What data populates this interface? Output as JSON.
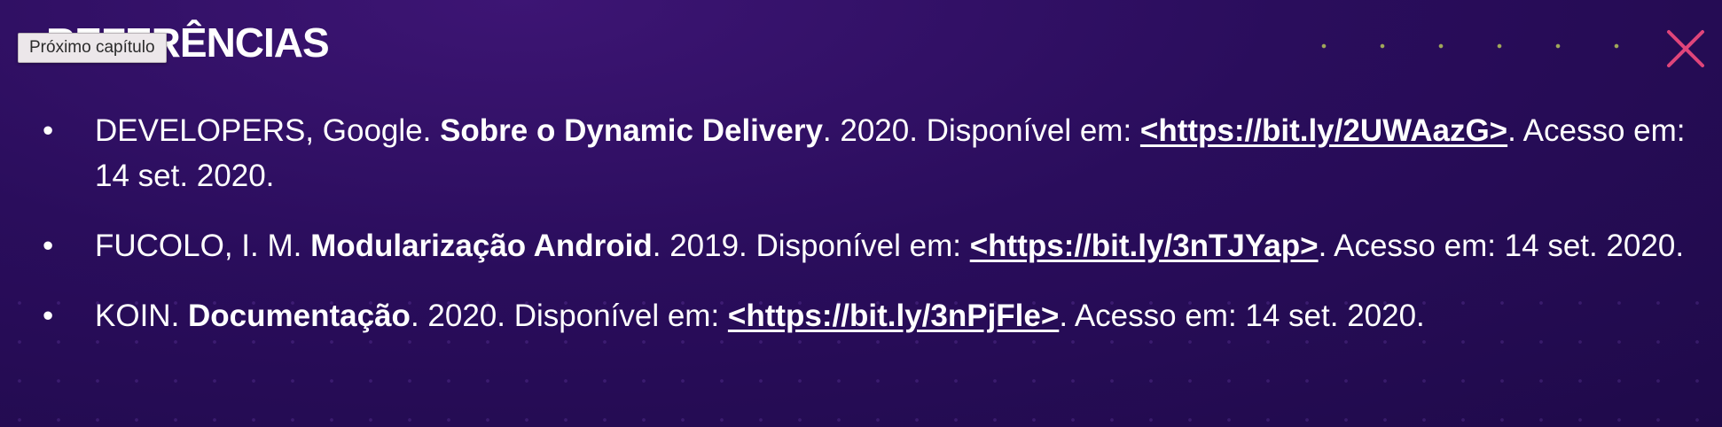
{
  "header": {
    "title": "REFERÊNCIAS",
    "tooltip": "Próximo capítulo"
  },
  "references": [
    {
      "pre": "DEVELOPERS, Google. ",
      "title": "Sobre o Dynamic Delivery",
      "mid": ". 2020. Disponível em: ",
      "link": "<https://bit.ly/2UWAazG>",
      "post": ". Acesso em: 14 set. 2020."
    },
    {
      "pre": "FUCOLO, I. M. ",
      "title": "Modularização Android",
      "mid": ". 2019. Disponível em: ",
      "link": "<https://bit.ly/3nTJYap>",
      "post": ". Acesso em: 14 set. 2020."
    },
    {
      "pre": "KOIN. ",
      "title": "Documentação",
      "mid": ". 2020. Disponível em: ",
      "link": "<https://bit.ly/3nPjFle>",
      "post": ". Acesso em: 14 set. 2020."
    }
  ],
  "colors": {
    "background": "#2a0d5c",
    "close_accent": "#e0457a",
    "text": "#ffffff"
  },
  "icons": {
    "close": "close-icon"
  }
}
